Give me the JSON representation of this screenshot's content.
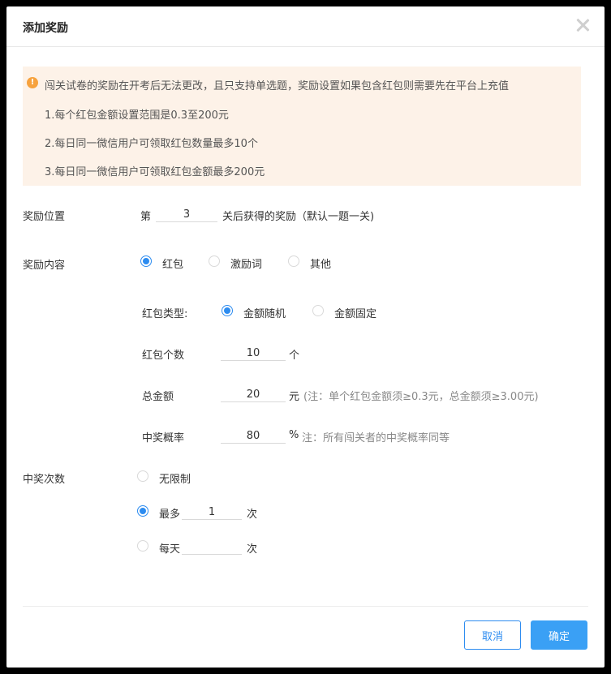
{
  "dialog": {
    "title": "添加奖励",
    "close_icon": "close-icon"
  },
  "notice": {
    "icon": "warning-icon",
    "main": "闯关试卷的奖励在开考后无法更改，且只支持单选题，奖励设置如果包含红包则需要先在平台上充值",
    "items": [
      "1.每个红包金额设置范围是0.3至200元",
      "2.每日同一微信用户可领取红包数量最多10个",
      "3.每日同一微信用户可领取红包金额最多200元"
    ]
  },
  "position": {
    "label": "奖励位置",
    "prefix": "第",
    "value": "3",
    "suffix": "关后获得的奖励（默认一题一关)"
  },
  "content": {
    "label": "奖励内容",
    "options": [
      "红包",
      "激励词",
      "其他"
    ],
    "selected": "红包"
  },
  "redpacket": {
    "type_label": "红包类型:",
    "type_options": [
      "金额随机",
      "金额固定"
    ],
    "type_selected": "金额随机",
    "count_label": "红包个数",
    "count_value": "10",
    "count_unit": "个",
    "total_label": "总金额",
    "total_value": "20",
    "total_unit": "元",
    "total_note": "(注：单个红包金额须≥0.3元，总金额须≥3.00元)",
    "rate_label": "中奖概率",
    "rate_value": "80",
    "rate_unit": "%",
    "rate_note": "注：所有闯关者的中奖概率同等"
  },
  "times": {
    "label": "中奖次数",
    "unlimited": "无限制",
    "max_label": "最多",
    "max_value": "1",
    "max_unit": "次",
    "daily_label": "每天",
    "daily_value": "",
    "daily_unit": "次",
    "selected": "最多"
  },
  "footer": {
    "cancel": "取消",
    "ok": "确定"
  },
  "colors": {
    "primary": "#2d8cf0",
    "warning": "#f7a23d",
    "notice_bg": "#fdf2e8"
  }
}
